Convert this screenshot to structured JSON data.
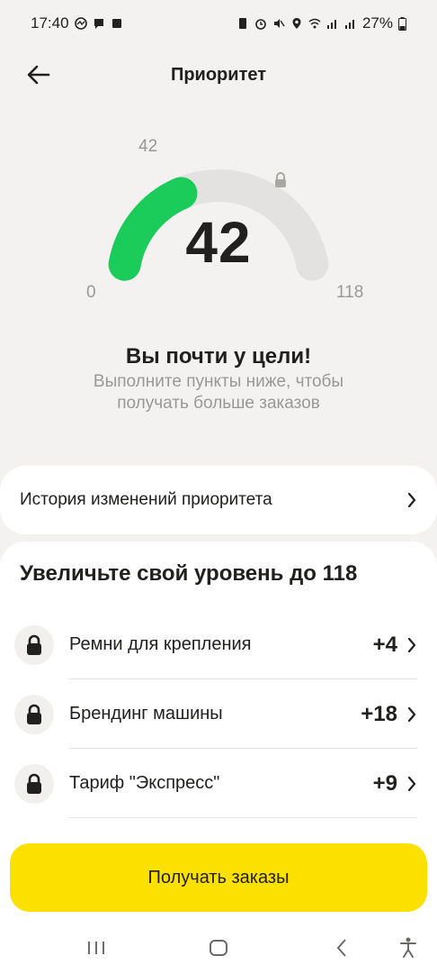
{
  "status_bar": {
    "time": "17:40",
    "battery": "27%"
  },
  "header": {
    "title": "Приоритет"
  },
  "gauge": {
    "value": "42",
    "current_marker": "42",
    "min_label": "0",
    "max_label": "118",
    "progress_value": 42,
    "max_value": 118,
    "fill_color": "#1bcc5b",
    "track_color": "#e3e2e0"
  },
  "message": {
    "headline": "Вы почти у цели!",
    "subtext": "Выполните пункты ниже, чтобы получать больше заказов"
  },
  "history": {
    "label": "История изменений приоритета"
  },
  "tasks": {
    "title": "Увеличьте свой уровень до 118",
    "items": [
      {
        "label": "Ремни для крепления",
        "points": "+4"
      },
      {
        "label": "Брендинг машины",
        "points": "+18"
      },
      {
        "label": "Тариф \"Экспресс\"",
        "points": "+9"
      }
    ]
  },
  "cta": {
    "label": "Получать заказы",
    "color": "#fce000"
  }
}
